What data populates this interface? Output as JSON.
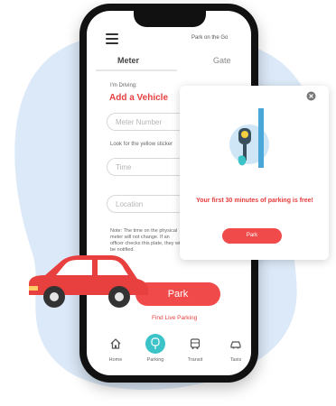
{
  "header": {
    "top_right": "Park on the Go"
  },
  "tabs": [
    {
      "label": "Meter"
    },
    {
      "label": "Gate"
    }
  ],
  "form": {
    "driving_label": "I'm Driving:",
    "add_vehicle": "Add a Vehicle",
    "meter_placeholder": "Meter Number",
    "meter_hint": "Look for the yellow sticker",
    "time_placeholder": "Time",
    "location_placeholder": "Location",
    "note": "Note: The time on the physical meter will not change. If an officer checks this plate, they will be notified."
  },
  "main": {
    "park_label": "Park",
    "find_live": "Find Live Parking"
  },
  "nav": [
    {
      "label": "Home",
      "icon": "home-icon"
    },
    {
      "label": "Parking",
      "icon": "parking-meter-icon"
    },
    {
      "label": "Transit",
      "icon": "bus-icon"
    },
    {
      "label": "Taxis",
      "icon": "taxi-icon"
    }
  ],
  "popup": {
    "message": "Your first 30 minutes of parking is free!",
    "button": "Park",
    "close_icon": "close-icon"
  },
  "colors": {
    "accent": "#f04a4a",
    "teal": "#3cc3c8",
    "blob": "#dce9f8"
  }
}
